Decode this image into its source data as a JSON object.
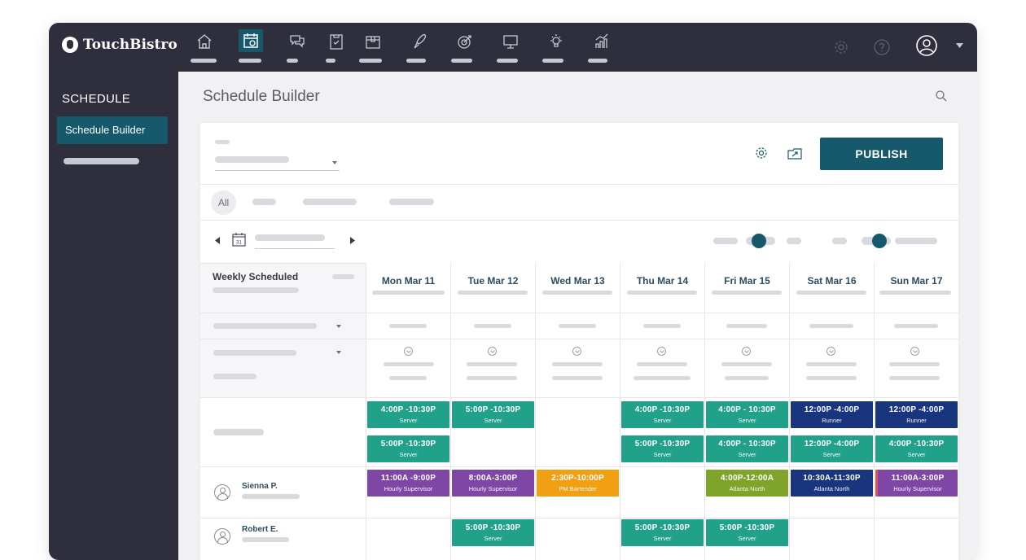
{
  "app": {
    "brand": "TouchBistro"
  },
  "topnav": {
    "icons": [
      "home-icon",
      "schedule-icon",
      "chat-icon",
      "clipboard-icon",
      "box-icon",
      "brush-icon",
      "target-icon",
      "monitor-icon",
      "bulb-icon",
      "chart-icon"
    ],
    "right_icons": [
      "gear-icon",
      "help-icon",
      "user-icon",
      "caret-down-icon"
    ]
  },
  "sidebar": {
    "title": "SCHEDULE",
    "items": [
      {
        "label": "Schedule Builder"
      }
    ]
  },
  "page": {
    "title": "Schedule Builder"
  },
  "toolbar": {
    "publish_label": "PUBLISH"
  },
  "filters": {
    "all_label": "All"
  },
  "grid": {
    "weekly_label": "Weekly Scheduled",
    "days": [
      "Mon Mar 11",
      "Tue Mar 12",
      "Wed Mar 13",
      "Thu Mar 14",
      "Fri Mar 15",
      "Sat Mar 16",
      "Sun Mar 17"
    ]
  },
  "employees": [
    "Sienna P.",
    "Robert E."
  ],
  "shifts": {
    "row1": [
      {
        "time": "4:00P -10:30P",
        "role": "Server"
      },
      {
        "time": "5:00P -10:30P",
        "role": "Server"
      },
      {
        "time": "4:00P -10:30P",
        "role": "Server"
      },
      {
        "time": "4:00P - 10:30P",
        "role": "Server"
      },
      {
        "time": "12:00P -4:00P",
        "role": "Runner"
      },
      {
        "time": "12:00P -4:00P",
        "role": "Runner"
      }
    ],
    "row2": [
      {
        "time": "5:00P -10:30P",
        "role": "Server"
      },
      {
        "time": "5:00P -10:30P",
        "role": "Server"
      },
      {
        "time": "4:00P - 10:30P",
        "role": "Server"
      },
      {
        "time": "12:00P -4:00P",
        "role": "Server"
      },
      {
        "time": "4:00P -10:30P",
        "role": "Server"
      }
    ],
    "sienna": [
      {
        "time": "11:00A -9:00P",
        "role": "Hourly Supervisor"
      },
      {
        "time": "8:00A-3:00P",
        "role": "Hourly Supervisor"
      },
      {
        "time": "2:30P-10:00P",
        "role": "PM Bartender"
      },
      {
        "time": "4:00P-12:00A",
        "role": "Atlanta North"
      },
      {
        "time": "10:30A-11:30P",
        "role": "Atlanta North"
      },
      {
        "time": "11:00A-3:00P",
        "role": "Hourly Supervisor"
      }
    ],
    "robert": [
      {
        "time": "5:00P -10:30P",
        "role": "Server"
      },
      {
        "time": "5:00P -10:30P",
        "role": "Server"
      },
      {
        "time": "5:00P -10:30P",
        "role": "Server"
      }
    ]
  },
  "colors": {
    "teal": "#16596b",
    "green": "#21a08a",
    "navy": "#19357e",
    "purple": "#7e47a6",
    "orange": "#f0a012",
    "olive": "#7ea42a",
    "dark": "#2f2e3d"
  }
}
